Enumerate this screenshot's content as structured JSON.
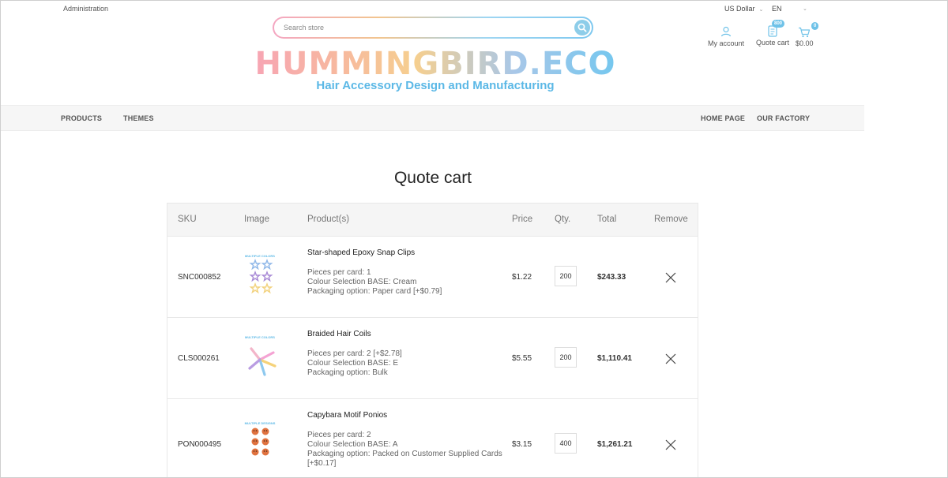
{
  "topbar": {
    "admin_label": "Administration",
    "currency_label": "US Dollar",
    "language_label": "EN"
  },
  "search": {
    "placeholder": "Search store"
  },
  "header": {
    "account_label": "My account",
    "quote_label": "Quote cart",
    "quote_badge": "800",
    "cart_badge": "0",
    "cart_total": "$0.00"
  },
  "brand": {
    "logo_text": "HUMMINGBIRD.ECO",
    "tagline": "Hair Accessory Design and Manufacturing"
  },
  "nav": {
    "left": [
      "PRODUCTS",
      "THEMES"
    ],
    "right": [
      "HOME PAGE",
      "OUR FACTORY"
    ]
  },
  "page": {
    "title": "Quote cart"
  },
  "table": {
    "headers": [
      "SKU",
      "Image",
      "Product(s)",
      "Price",
      "Qty.",
      "Total",
      "Remove"
    ],
    "rows": [
      {
        "sku": "SNC000852",
        "name": "Star-shaped Epoxy Snap Clips",
        "options": [
          "Pieces per card: 1",
          "Colour Selection BASE: Cream",
          "Packaging option: Paper card [+$0.79]"
        ],
        "price": "$1.22",
        "qty": "200",
        "total": "$243.33",
        "image_label": "MULTIPLE COLORS",
        "icon": "star-clips-image"
      },
      {
        "sku": "CLS000261",
        "name": "Braided Hair Coils",
        "options": [
          "Pieces per card: 2 [+$2.78]",
          "Colour Selection BASE: E",
          "Packaging option: Bulk"
        ],
        "price": "$5.55",
        "qty": "200",
        "total": "$1,110.41",
        "image_label": "MULTIPLE COLORS",
        "icon": "hair-coils-image"
      },
      {
        "sku": "PON000495",
        "name": "Capybara Motif Ponios",
        "options": [
          "Pieces per card: 2",
          "Colour Selection BASE: A",
          "Packaging option: Packed on Customer Supplied Cards [+$0.17]"
        ],
        "price": "$3.15",
        "qty": "400",
        "total": "$1,261.21",
        "image_label": "MULTIPLE DESIGNS",
        "icon": "capybara-ponios-image"
      }
    ]
  },
  "colors": {
    "accent_blue": "#6fc2e8",
    "tagline_blue": "#5bb8e6",
    "logo_pink": "#f7a1b8",
    "logo_yellow": "#f6cf8f",
    "logo_blue": "#6cc7f0"
  }
}
